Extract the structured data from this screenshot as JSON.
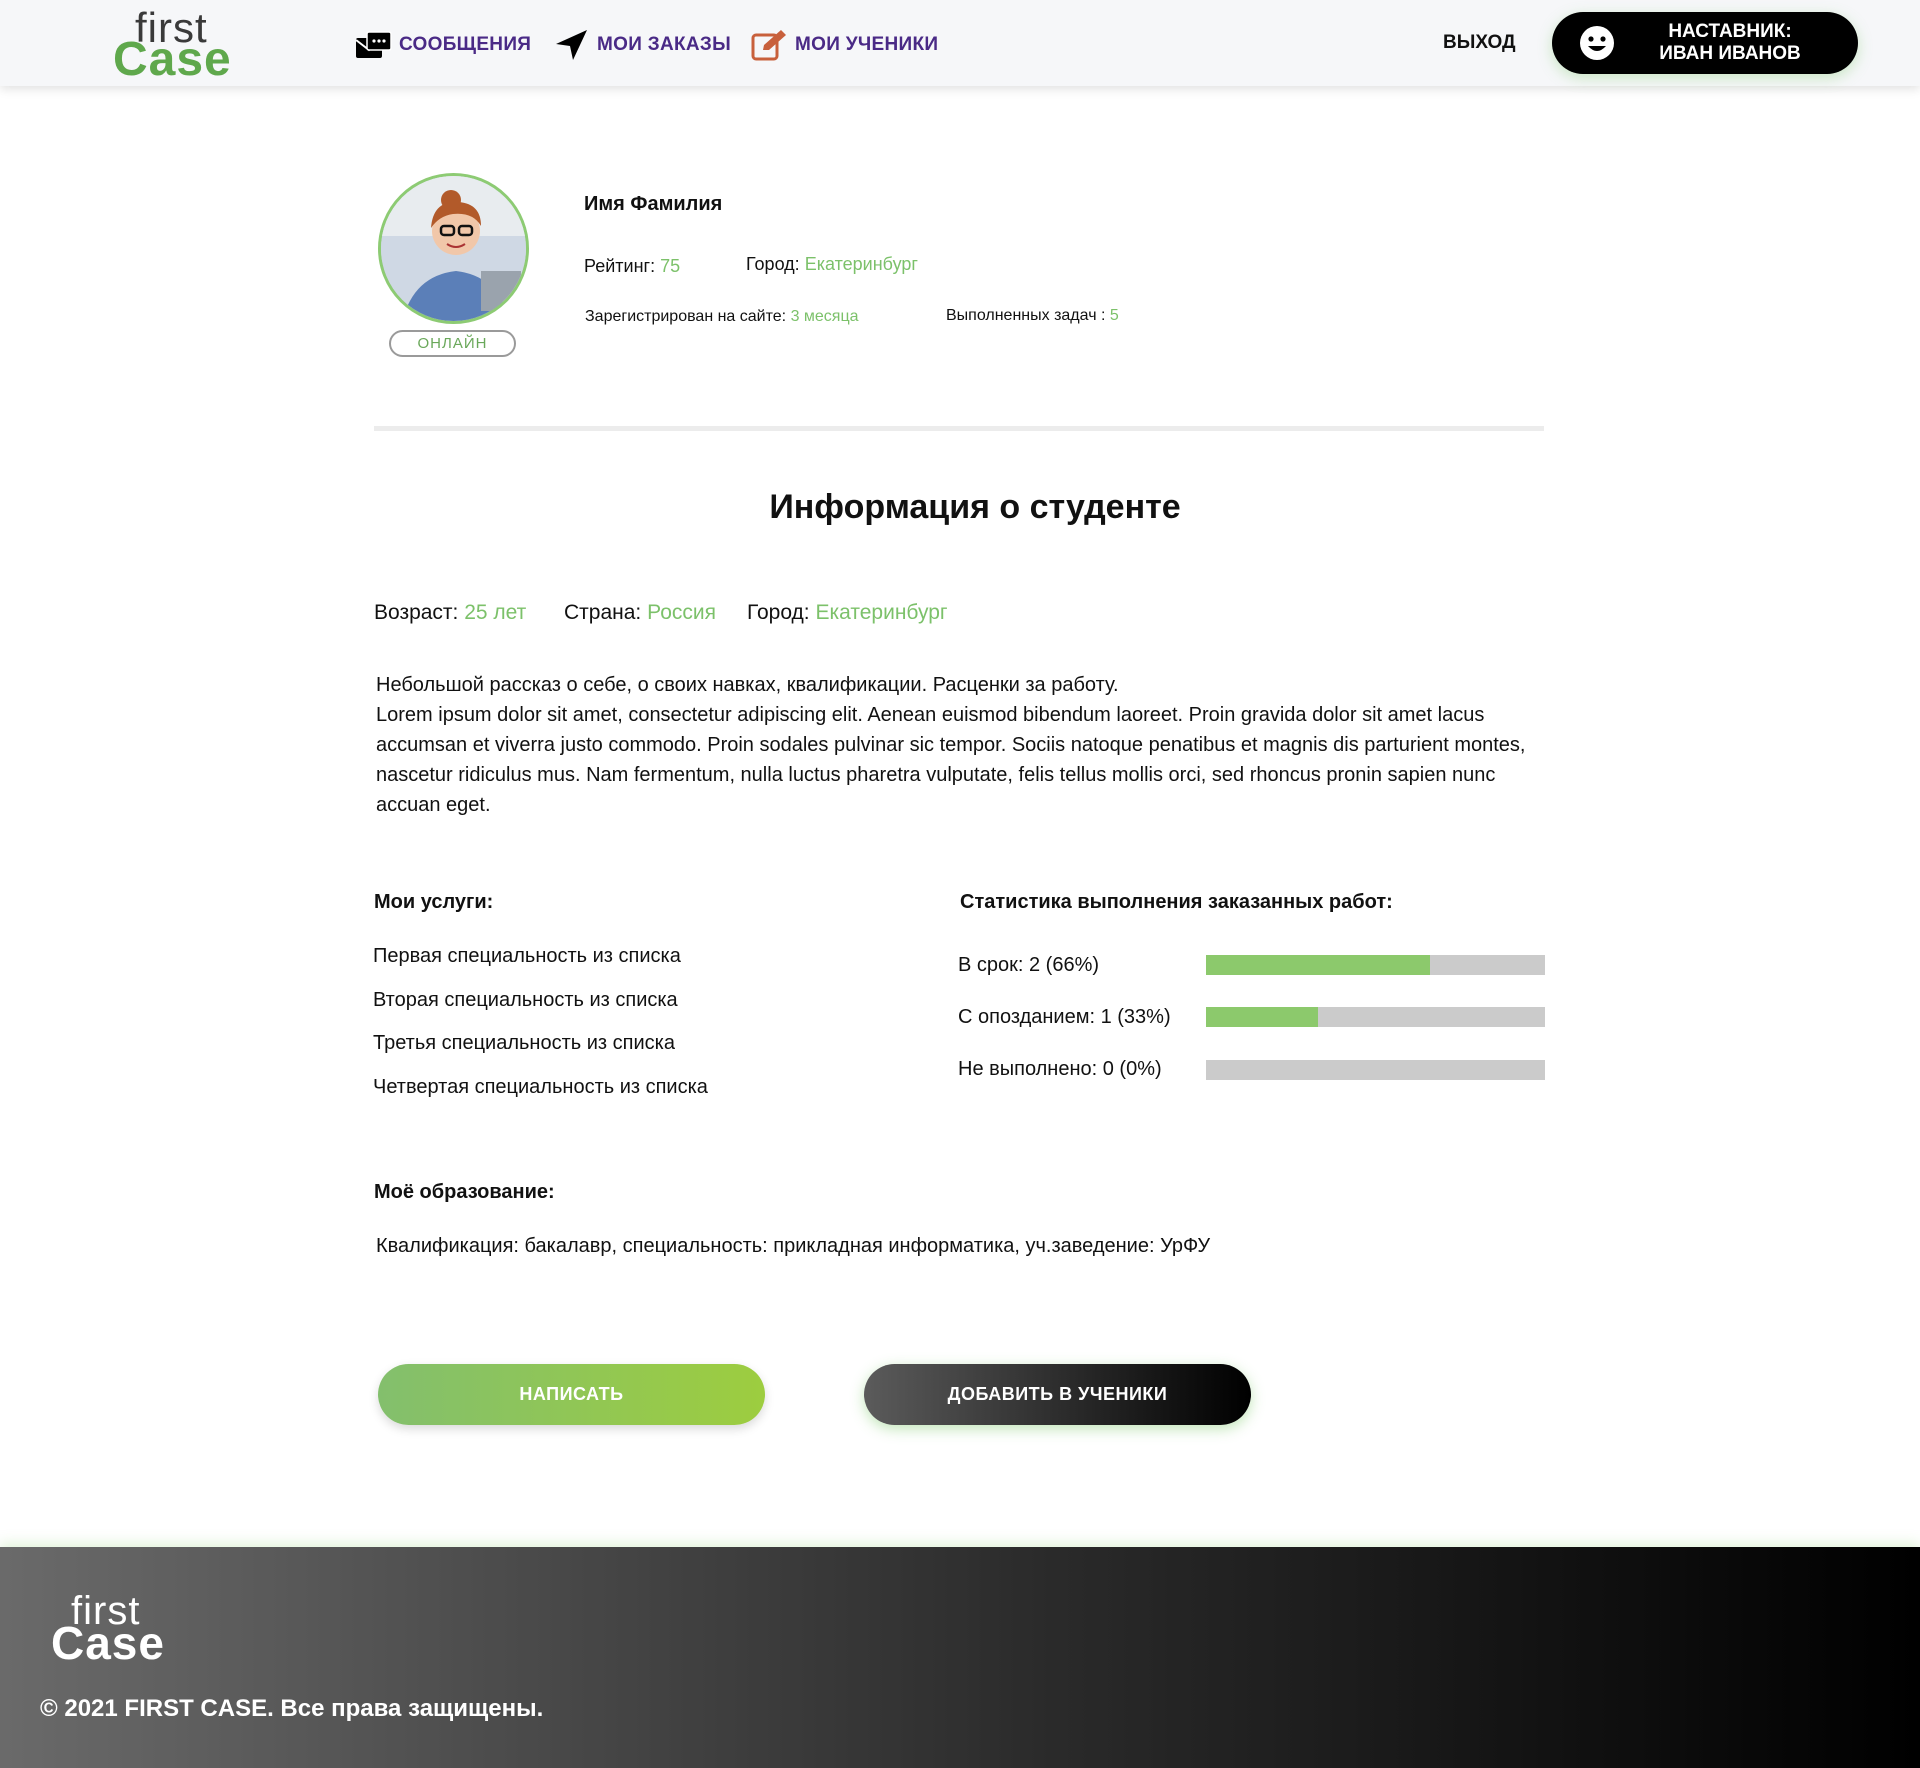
{
  "header": {
    "logo": {
      "line1": "first",
      "line2": "Case"
    },
    "nav": [
      {
        "label": "СООБЩЕНИЯ",
        "icon": "messages-icon"
      },
      {
        "label": "МОИ ЗАКАЗЫ",
        "icon": "send-icon"
      },
      {
        "label": "МОИ УЧЕНИКИ",
        "icon": "edit-icon"
      }
    ],
    "logout_label": "ВЫХОД",
    "mentor": {
      "line1": "НАСТАВНИК:",
      "line2": "ИВАН ИВАНОВ",
      "icon": "smile-icon"
    }
  },
  "profile": {
    "status": "ОНЛАЙН",
    "name": "Имя Фамилия",
    "rating_label": "Рейтинг:",
    "rating_value": "75",
    "city_label": "Город:",
    "city_value": "Екатеринбург",
    "registered_label": "Зарегистрирован на сайте:",
    "registered_value": "3 месяца",
    "tasks_label": "Выполненных задач :",
    "tasks_value": "5"
  },
  "info": {
    "title": "Информация о студенте",
    "age_label": "Возраст:",
    "age_value": "25 лет",
    "country_label": "Страна:",
    "country_value": "Россия",
    "city_label": "Город:",
    "city_value": "Екатеринбург",
    "about_line1": "Небольшой рассказ о себе, о своих навках, квалификации. Расценки за работу.",
    "about_line2": "Lorem ipsum dolor sit amet, consectetur adipiscing elit. Aenean euismod bibendum laoreet. Proin gravida dolor sit amet lacus accumsan et viverra justo commodo. Proin sodales pulvinar sic tempor. Sociis natoque penatibus et magnis dis parturient montes, nascetur ridiculus mus. Nam fermentum, nulla luctus pharetra vulputate, felis tellus mollis orci, sed rhoncus pronin sapien nunc accuan eget."
  },
  "services": {
    "title": "Мои услуги:",
    "items": [
      "Первая специальность из списка",
      "Вторая специальность из списка",
      "Третья специальность из списка",
      "Четвертая специальность из списка"
    ]
  },
  "stats": {
    "title": "Статистика выполнения заказанных работ:",
    "items": [
      {
        "label": "В срок: 2 (66%)",
        "value": 66
      },
      {
        "label": "С опозданием: 1 (33%)",
        "value": 33
      },
      {
        "label": "Не выполнено: 0 (0%)",
        "value": 0
      }
    ],
    "fill_color": "#8cc96c",
    "track_color": "#cbcbcb"
  },
  "education": {
    "title": "Моё образование:",
    "text": "Квалификация: бакалавр, специальность: прикладная информатика, уч.заведение: УрФУ"
  },
  "actions": {
    "write_label": "НАПИСАТЬ",
    "add_label": "ДОБАВИТЬ В УЧЕНИКИ"
  },
  "footer": {
    "logo": {
      "line1": "first",
      "line2": "Case"
    },
    "copyright": "© 2021 FIRST CASE. Все права защищены."
  }
}
